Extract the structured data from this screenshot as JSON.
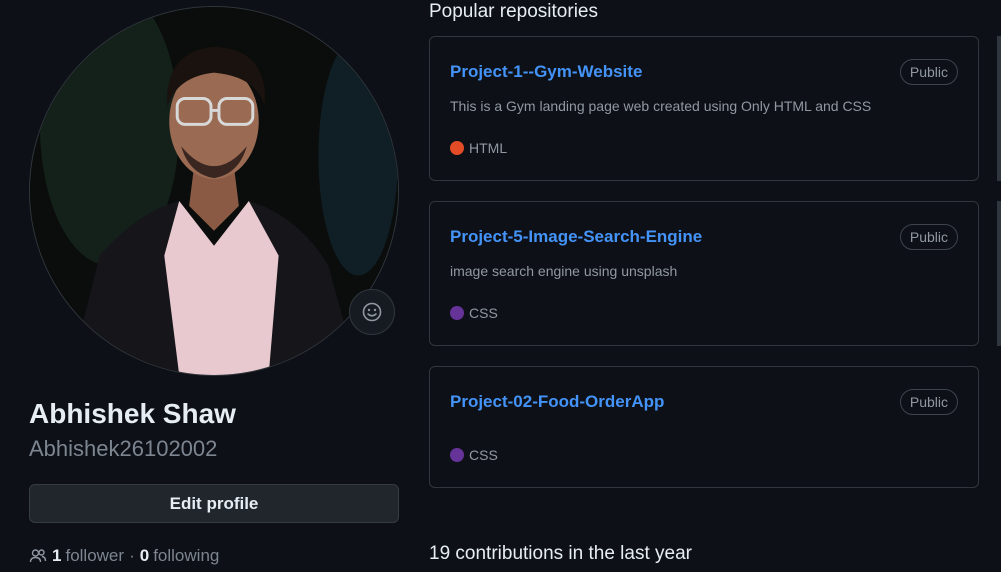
{
  "profile": {
    "name": "Abhishek Shaw",
    "username": "Abhishek26102002",
    "avatar_alt": "profile-photo",
    "edit_button": "Edit profile",
    "followers_count": "1",
    "followers_label": "follower",
    "following_count": "0",
    "following_label": "following",
    "separator": "·"
  },
  "popular": {
    "title": "Popular repositories",
    "repos": [
      {
        "name": "Project-1--Gym-Website",
        "visibility": "Public",
        "description": "This is a Gym landing page web created using Only HTML and CSS",
        "language": "HTML",
        "language_color": "#e34c26"
      },
      {
        "name": "Project-5-Image-Search-Engine",
        "visibility": "Public",
        "description": "image search engine using unsplash",
        "language": "CSS",
        "language_color": "#663399"
      },
      {
        "name": "Project-02-Food-OrderApp",
        "visibility": "Public",
        "description": "",
        "language": "CSS",
        "language_color": "#663399"
      }
    ]
  },
  "contributions": {
    "title": "19 contributions in the last year"
  },
  "icons": {
    "status": "smiley-icon",
    "people": "people-icon"
  }
}
